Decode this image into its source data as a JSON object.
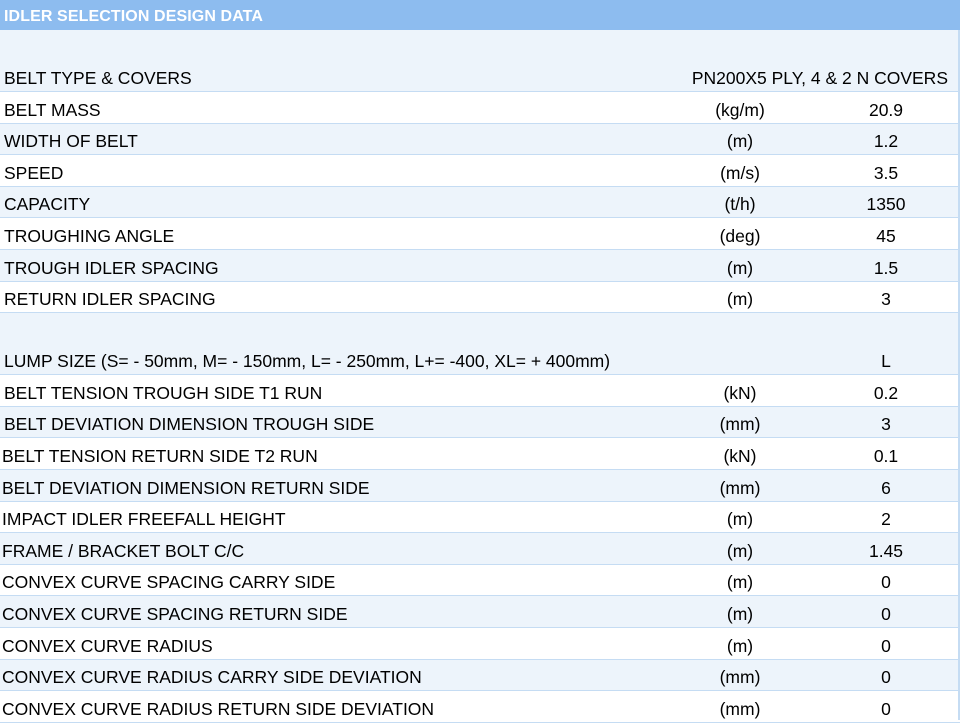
{
  "title": "IDLER SELECTION DESIGN DATA",
  "rows": [
    {
      "label": "BELT TYPE & COVERS",
      "unit": "",
      "value": "PN200X5 PLY, 4 & 2 N COVERS"
    },
    {
      "label": "BELT MASS",
      "unit": "(kg/m)",
      "value": "20.9"
    },
    {
      "label": "WIDTH OF BELT",
      "unit": "(m)",
      "value": "1.2"
    },
    {
      "label": "SPEED",
      "unit": "(m/s)",
      "value": "3.5"
    },
    {
      "label": "CAPACITY",
      "unit": "(t/h)",
      "value": "1350"
    },
    {
      "label": "TROUGHING ANGLE",
      "unit": "(deg)",
      "value": "45"
    },
    {
      "label": "TROUGH IDLER SPACING",
      "unit": "(m)",
      "value": "1.5"
    },
    {
      "label": "RETURN IDLER SPACING",
      "unit": "(m)",
      "value": "3"
    },
    {
      "label": "LUMP SIZE (S= - 50mm, M= - 150mm, L= - 250mm, L+= -400, XL= + 400mm)",
      "unit": "",
      "value": "L"
    },
    {
      "label": "BELT TENSION TROUGH SIDE T1 RUN",
      "unit": "(kN)",
      "value": "0.2"
    },
    {
      "label": "BELT DEVIATION DIMENSION TROUGH SIDE",
      "unit": "(mm)",
      "value": "3"
    },
    {
      "label": "BELT TENSION RETURN SIDE T2 RUN",
      "unit": "(kN)",
      "value": "0.1"
    },
    {
      "label": "BELT DEVIATION DIMENSION RETURN SIDE",
      "unit": "(mm)",
      "value": "6"
    },
    {
      "label": "IMPACT IDLER FREEFALL HEIGHT",
      "unit": "(m)",
      "value": "2"
    },
    {
      "label": "FRAME / BRACKET BOLT C/C",
      "unit": "(m)",
      "value": "1.45"
    },
    {
      "label": "CONVEX CURVE SPACING CARRY SIDE",
      "unit": "(m)",
      "value": "0"
    },
    {
      "label": "CONVEX CURVE SPACING RETURN SIDE",
      "unit": "(m)",
      "value": "0"
    },
    {
      "label": "CONVEX CURVE RADIUS",
      "unit": "(m)",
      "value": "0"
    },
    {
      "label": "CONVEX CURVE RADIUS CARRY SIDE DEVIATION",
      "unit": "(mm)",
      "value": "0"
    },
    {
      "label": "CONVEX CURVE RADIUS RETURN SIDE DEVIATION",
      "unit": "(mm)",
      "value": "0"
    }
  ]
}
